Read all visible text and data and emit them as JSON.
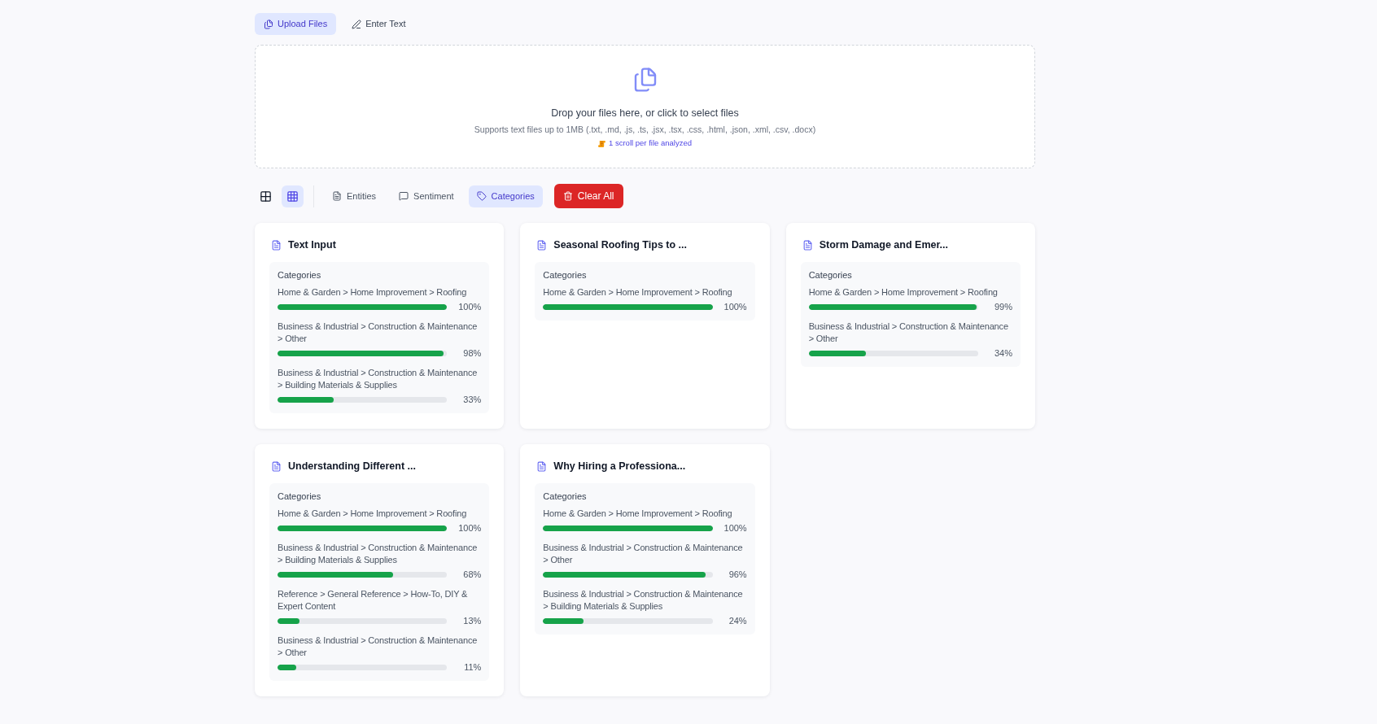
{
  "input_tabs": [
    {
      "kind": "upload",
      "label": "Upload Files",
      "selected": true
    },
    {
      "kind": "text",
      "label": "Enter Text",
      "selected": false
    }
  ],
  "dropzone": {
    "title": "Drop your files here, or click to select files",
    "subtitle": "Supports text files up to 1MB (.txt, .md, .js, .ts, .jsx, .tsx, .css, .html, .json, .xml, .csv, .docx)",
    "note": "1 scroll per file analyzed"
  },
  "toolbar": {
    "view_modes": [
      {
        "kind": "grid-2x2",
        "selected": false
      },
      {
        "kind": "grid-3x3",
        "selected": true
      }
    ],
    "analysis_tabs": [
      {
        "kind": "entities",
        "label": "Entities",
        "selected": false
      },
      {
        "kind": "sentiment",
        "label": "Sentiment",
        "selected": false
      },
      {
        "kind": "categories",
        "label": "Categories",
        "selected": true
      }
    ],
    "clear_button": "Clear All"
  },
  "cards": [
    {
      "title": "Text Input",
      "section_label": "Categories",
      "categories": [
        {
          "path": "Home & Garden > Home Improvement > Roofing",
          "level": 1.0,
          "reading": "100%"
        },
        {
          "path": "Business & Industrial > Construction & Maintenance > Other",
          "level": 0.98,
          "reading": "98%"
        },
        {
          "path": "Business & Industrial > Construction & Maintenance > Building Materials & Supplies",
          "level": 0.33,
          "reading": "33%"
        }
      ]
    },
    {
      "title": "Seasonal Roofing Tips to ...",
      "section_label": "Categories",
      "categories": [
        {
          "path": "Home & Garden > Home Improvement > Roofing",
          "level": 1.0,
          "reading": "100%"
        }
      ]
    },
    {
      "title": "Storm Damage and Emer...",
      "section_label": "Categories",
      "categories": [
        {
          "path": "Home & Garden > Home Improvement > Roofing",
          "level": 0.99,
          "reading": "99%"
        },
        {
          "path": "Business & Industrial > Construction & Maintenance > Other",
          "level": 0.34,
          "reading": "34%"
        }
      ]
    },
    {
      "title": "Understanding Different ...",
      "section_label": "Categories",
      "categories": [
        {
          "path": "Home & Garden > Home Improvement > Roofing",
          "level": 1.0,
          "reading": "100%"
        },
        {
          "path": "Business & Industrial > Construction & Maintenance > Building Materials & Supplies",
          "level": 0.68,
          "reading": "68%"
        },
        {
          "path": "Reference > General Reference > How-To, DIY & Expert Content",
          "level": 0.13,
          "reading": "13%"
        },
        {
          "path": "Business & Industrial > Construction & Maintenance > Other",
          "level": 0.11,
          "reading": "11%"
        }
      ]
    },
    {
      "title": "Why Hiring a Professiona...",
      "section_label": "Categories",
      "categories": [
        {
          "path": "Home & Garden > Home Improvement > Roofing",
          "level": 1.0,
          "reading": "100%"
        },
        {
          "path": "Business & Industrial > Construction & Maintenance > Other",
          "level": 0.96,
          "reading": "96%"
        },
        {
          "path": "Business & Industrial > Construction & Maintenance > Building Materials & Supplies",
          "level": 0.24,
          "reading": "24%"
        }
      ]
    }
  ]
}
